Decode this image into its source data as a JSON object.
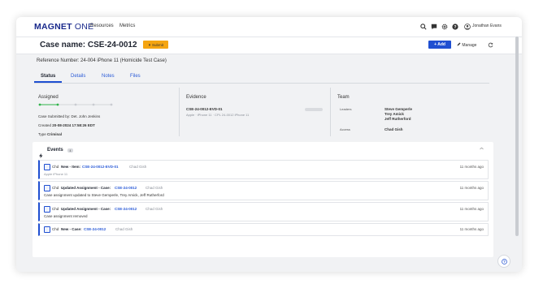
{
  "app": {
    "logo_main": "MAGNET",
    "logo_sub": "ONE",
    "nav": [
      "Resources",
      "Metrics"
    ],
    "user_name": "Jonathan Evans"
  },
  "case": {
    "title": "Case name: CSE-24-0012",
    "submit_label": "Submit",
    "add_label": "+ Add",
    "manage_label": "Manage",
    "reference": "Reference Number: 24-004 iPhone 11 (Homicide Test Case)"
  },
  "tabs": [
    "Status",
    "Details",
    "Notes",
    "Files"
  ],
  "status": {
    "heading": "Assigned",
    "submitted_by": "Case Submitted by: Det. John Jenkins",
    "created_label": "Created",
    "created_value": "20-08-2024 17:58:26 EDT",
    "type_label": "Type",
    "type_value": "Criminal",
    "steps_completed": 2,
    "steps_total": 5
  },
  "evidence": {
    "heading": "Evidence",
    "item_id": "CSE-24-0012-EVD-01",
    "item_meta": "Apple  ·  iPhone 11  ·  CPL 24-0012 iPhone 11"
  },
  "team": {
    "heading": "Team",
    "leaders_label": "Leaders",
    "leaders": [
      "Steve Gemperle",
      "Trey Amick",
      "Jeff Rutherford"
    ],
    "access_label": "Access",
    "access": "Chad Gish"
  },
  "events": {
    "title": "Events",
    "count": "4",
    "items": [
      {
        "role": "Chd",
        "action": "New - Item:",
        "link": "CSE-24-0012-EVD-01",
        "user": "Chad Gish",
        "time": "11 months ago",
        "desc": "",
        "sub": "Apple    iPhone 11"
      },
      {
        "role": "Chd",
        "action": "Updated Assignment - Case:",
        "link": "CSE-24-0012",
        "user": "Chad Gish",
        "time": "11 months ago",
        "desc": "Case assignment updated to Steve Gemperle, Trey Amick, Jeff Rutherford",
        "sub": ""
      },
      {
        "role": "Chd",
        "action": "Updated Assignment - Case:",
        "link": "CSE-24-0012",
        "user": "Chad Gish",
        "time": "11 months ago",
        "desc": "Case assignment removed",
        "sub": ""
      },
      {
        "role": "Chd",
        "action": "New - Case:",
        "link": "CSE-24-0012",
        "user": "Chad Gish",
        "time": "11 months ago",
        "desc": "",
        "sub": ""
      }
    ]
  },
  "colors": {
    "brand": "#1a2a8c",
    "accent": "#1f4fd1",
    "submit": "#f5a511",
    "step_done": "#2fb44a"
  },
  "icons": [
    "search-icon",
    "chat-icon",
    "gear-icon",
    "help-icon",
    "user-icon",
    "refresh-icon",
    "pencil-icon",
    "bolt-icon",
    "case-icon"
  ]
}
